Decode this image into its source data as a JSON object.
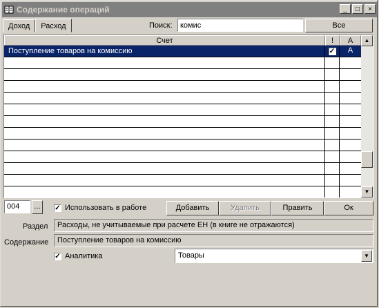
{
  "window": {
    "title": "Содержание операций",
    "minimize": "_",
    "maximize": "□",
    "close": "×"
  },
  "tabs": [
    {
      "label": "Доход"
    },
    {
      "label": "Расход"
    }
  ],
  "search": {
    "label": "Поиск:",
    "value": "комис"
  },
  "all_button": "Все",
  "grid": {
    "columns": [
      "Счет",
      "!",
      "А"
    ],
    "rows": [
      {
        "account": "Поступление товаров на комиссию",
        "flag": true,
        "a": "А",
        "selected": true
      }
    ],
    "empty_rows": 11
  },
  "code": {
    "value": "004",
    "browse_label": "..."
  },
  "use_in_work": {
    "label": "Использовать в работе",
    "checked": true
  },
  "buttons": {
    "add": "Добавить",
    "delete": "Удалить",
    "edit": "Править",
    "ok": "Ок"
  },
  "section": {
    "label": "Раздел",
    "value": "Расходы, не учитываемые при расчете ЕН (в книге не отражаются)"
  },
  "content": {
    "label": "Содержание",
    "value": "Поступление товаров на комиссию"
  },
  "analytics": {
    "label": "Аналитика",
    "checked": true,
    "selected": "Товары"
  }
}
